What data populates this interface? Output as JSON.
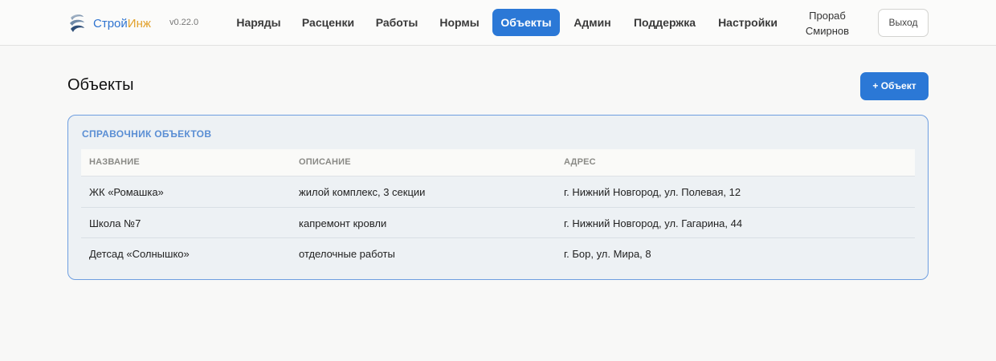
{
  "app": {
    "name_part1": "Строй",
    "name_part2": "Инж",
    "version": "v0.22.0",
    "logo_icon": "spiral-logo-icon"
  },
  "nav": {
    "items": [
      {
        "label": "Наряды",
        "active": false
      },
      {
        "label": "Расценки",
        "active": false
      },
      {
        "label": "Работы",
        "active": false
      },
      {
        "label": "Нормы",
        "active": false
      },
      {
        "label": "Объекты",
        "active": true
      },
      {
        "label": "Админ",
        "active": false
      },
      {
        "label": "Поддержка",
        "active": false
      },
      {
        "label": "Настройки",
        "active": false
      }
    ]
  },
  "user": {
    "line1": "Прораб",
    "line2": "Смирнов",
    "logout_label": "Выход"
  },
  "page": {
    "title": "Объекты",
    "add_button_label": "+ Объект"
  },
  "card": {
    "title": "СПРАВОЧНИК ОБЪЕКТОВ",
    "columns": [
      "НАЗВАНИЕ",
      "ОПИСАНИЕ",
      "АДРЕС"
    ],
    "rows": [
      [
        "ЖК «Ромашка»",
        "жилой комплекс, 3 секции",
        "г. Нижний Новгород, ул. Полевая, 12"
      ],
      [
        "Школа №7",
        "капремонт кровли",
        "г. Нижний Новгород, ул. Гагарина, 44"
      ],
      [
        "Детсад «Солнышко»",
        "отделочные работы",
        "г. Бор, ул. Мира, 8"
      ]
    ]
  },
  "colors": {
    "accent": "#2b78d6",
    "brand_blue": "#2f74d0",
    "brand_orange": "#e2a12b",
    "card_border": "#6e9ee0"
  }
}
